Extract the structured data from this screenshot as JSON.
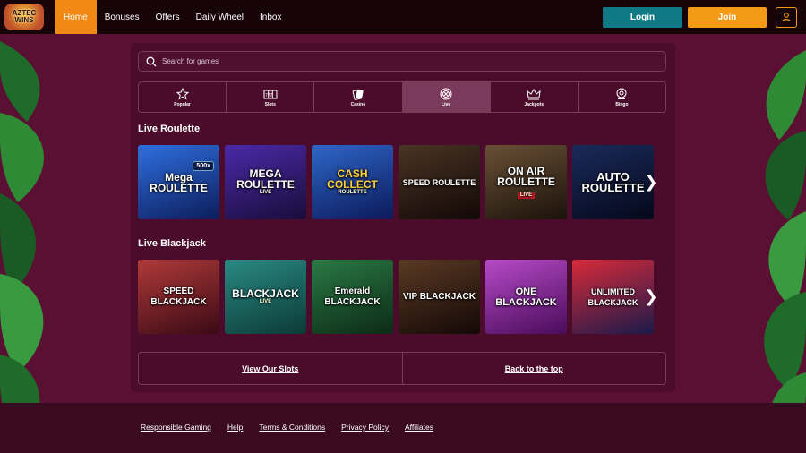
{
  "brand": {
    "logo_line1": "AZTEC",
    "logo_line2": "WINS"
  },
  "nav": [
    {
      "label": "Home",
      "active": true
    },
    {
      "label": "Bonuses"
    },
    {
      "label": "Offers"
    },
    {
      "label": "Daily Wheel"
    },
    {
      "label": "Inbox"
    }
  ],
  "actions": {
    "login": "Login",
    "join": "Join",
    "user_icon": "user-icon"
  },
  "search": {
    "placeholder": "Search for games",
    "icon": "search-icon"
  },
  "categories": [
    {
      "label": "Popular",
      "icon": "star-icon"
    },
    {
      "label": "Slots",
      "icon": "slot-machine-icon"
    },
    {
      "label": "Casino",
      "icon": "cards-icon"
    },
    {
      "label": "Live",
      "icon": "chip-icon",
      "active": true
    },
    {
      "label": "Jackpots",
      "icon": "crown-icon"
    },
    {
      "label": "Bingo",
      "icon": "bingo-ball-icon"
    }
  ],
  "sections": [
    {
      "title": "Live Roulette",
      "games": [
        {
          "name": "Mega ROULETTE",
          "badge": "500x",
          "bg": "#1b4aa8"
        },
        {
          "name": "MEGA ROULETTE",
          "sub": "LIVE",
          "bg": "#2b1e6e"
        },
        {
          "name": "CASH COLLECT",
          "sub": "ROULETTE",
          "bg": "#1c3c8c"
        },
        {
          "name": "SPEED ROULETTE",
          "bg": "#2a1a14"
        },
        {
          "name": "ON AIR ROULETTE",
          "sub": "LIVE",
          "bg": "#3a2a1c"
        },
        {
          "name": "AUTO ROULETTE",
          "bg": "#0f1a3a"
        }
      ]
    },
    {
      "title": "Live Blackjack",
      "games": [
        {
          "name": "SPEED BLACKJACK",
          "bg": "#7a1f2a"
        },
        {
          "name": "BLACKJACK",
          "sub": "LIVE",
          "bg": "#1c6a66"
        },
        {
          "name": "Emerald BLACKJACK",
          "bg": "#1f5a34"
        },
        {
          "name": "VIP BLACKJACK",
          "bg": "#3a1a14"
        },
        {
          "name": "ONE BLACKJACK",
          "bg": "#8a2a9a"
        },
        {
          "name": "UNLIMITED BLACKJACK",
          "bg": "#c41a2a"
        }
      ]
    }
  ],
  "bottom_links": {
    "slots": "View Our Slots",
    "top": "Back to the top"
  },
  "footer_links": [
    "Responsible Gaming",
    "Help",
    "Terms & Conditions",
    "Privacy Policy",
    "Affiliates"
  ]
}
